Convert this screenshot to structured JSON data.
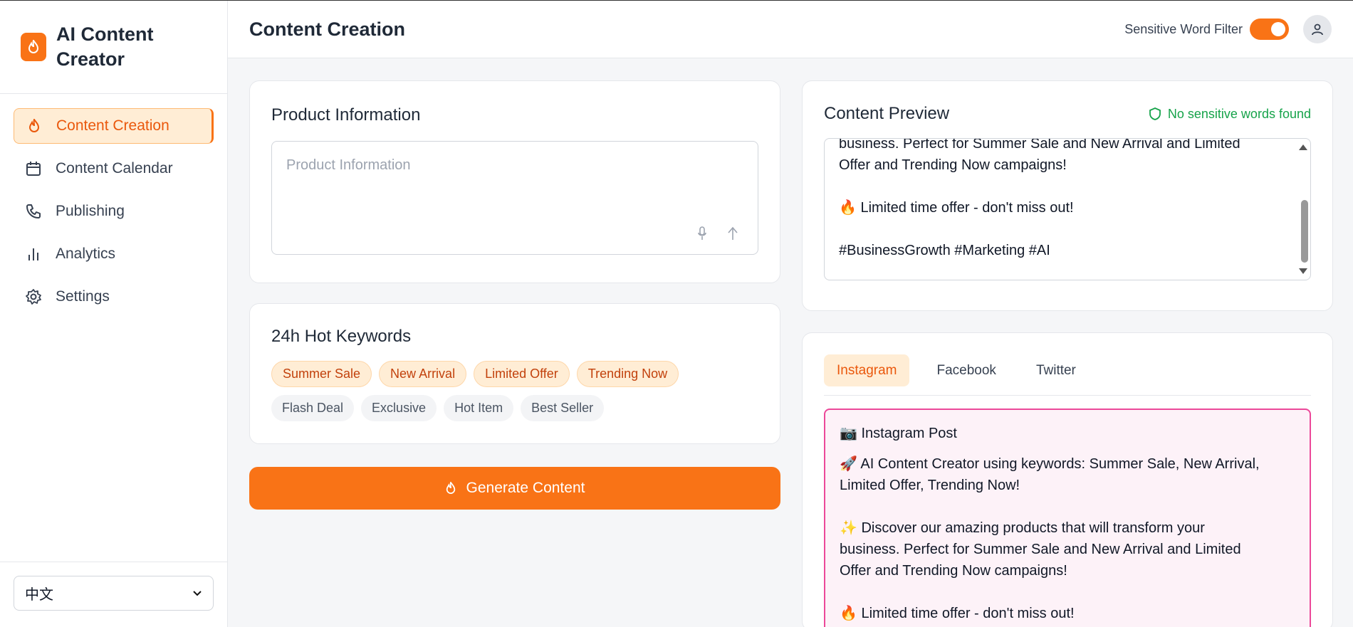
{
  "brand": {
    "title": "AI Content Creator"
  },
  "nav": {
    "items": [
      {
        "label": "Content Creation",
        "icon": "flame-icon"
      },
      {
        "label": "Content Calendar",
        "icon": "calendar-icon"
      },
      {
        "label": "Publishing",
        "icon": "phone-icon"
      },
      {
        "label": "Analytics",
        "icon": "bar-chart-icon"
      },
      {
        "label": "Settings",
        "icon": "gear-icon"
      }
    ]
  },
  "language": {
    "selected": "中文"
  },
  "header": {
    "title": "Content Creation",
    "filter_label": "Sensitive Word Filter",
    "filter_on": true
  },
  "product": {
    "title": "Product Information",
    "placeholder": "Product Information"
  },
  "keywords": {
    "title": "24h Hot Keywords",
    "hot": [
      "Summer Sale",
      "New Arrival",
      "Limited Offer",
      "Trending Now"
    ],
    "normal": [
      "Flash Deal",
      "Exclusive",
      "Hot Item",
      "Best Seller"
    ]
  },
  "generate": {
    "label": "Generate Content"
  },
  "preview": {
    "title": "Content Preview",
    "status": "No sensitive words found",
    "text": "business. Perfect for Summer Sale and New Arrival and Limited\nOffer and Trending Now campaigns!\n\n🔥 Limited time offer - don't miss out!\n\n#BusinessGrowth #Marketing #AI"
  },
  "platforms": {
    "tabs": [
      "Instagram",
      "Facebook",
      "Twitter"
    ],
    "active": "Instagram",
    "post_header": "📷 Instagram Post",
    "post_text": "🚀 AI Content Creator using keywords: Summer Sale, New Arrival,\nLimited Offer, Trending Now!\n\n✨ Discover our amazing products that will transform your\nbusiness. Perfect for Summer Sale and New Arrival and Limited\nOffer and Trending Now campaigns!\n\n🔥 Limited time offer - don't miss out!"
  },
  "colors": {
    "accent": "#f97316",
    "success": "#16a34a",
    "instagram": "#ec4899"
  }
}
